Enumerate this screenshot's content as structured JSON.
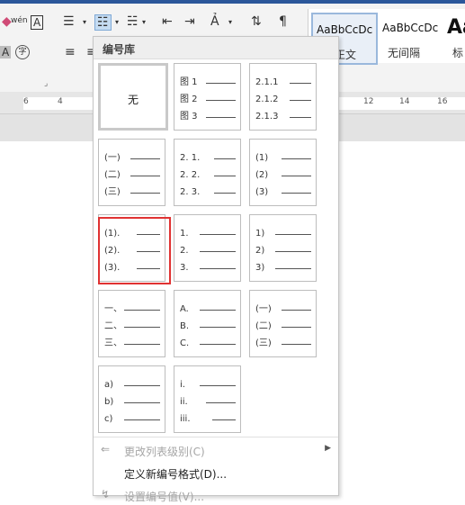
{
  "ribbon": {
    "font_wen_label": "wén",
    "font_a_boxed": "A",
    "font_a_gray": "A",
    "char_circle": "字",
    "styles": [
      {
        "sample": "AaBbCcDc",
        "label": "正文",
        "selected": true
      },
      {
        "sample": "AaBbCcDc",
        "label": "无间隔",
        "selected": false
      },
      {
        "sample": "Aa",
        "label": "标",
        "selected": false
      }
    ]
  },
  "ruler": {
    "left_numbers": [
      "6",
      "4"
    ],
    "right_numbers": [
      "12",
      "14",
      "16"
    ]
  },
  "numbering_library": {
    "title": "编号库",
    "none_label": "无",
    "tiles": [
      {
        "markers": [
          "图 1",
          "图 2",
          "图 3"
        ]
      },
      {
        "markers": [
          "2.1.1",
          "2.1.2",
          "2.1.3"
        ]
      },
      {
        "markers": [
          "(一)",
          "(二)",
          "(三)"
        ]
      },
      {
        "markers": [
          "2. 1.",
          "2. 2.",
          "2. 3."
        ]
      },
      {
        "markers": [
          "(1)",
          "(2)",
          "(3)"
        ]
      },
      {
        "markers": [
          "(1).",
          "(2).",
          "(3)."
        ]
      },
      {
        "markers": [
          "1.",
          "2.",
          "3."
        ]
      },
      {
        "markers": [
          "1)",
          "2)",
          "3)"
        ]
      },
      {
        "markers": [
          "一、",
          "二、",
          "三、"
        ]
      },
      {
        "markers": [
          "A.",
          "B.",
          "C."
        ]
      },
      {
        "markers": [
          "(一)",
          "(二)",
          "(三)"
        ]
      },
      {
        "markers": [
          "a)",
          "b)",
          "c)"
        ]
      },
      {
        "markers": [
          "i.",
          "ii.",
          "iii."
        ]
      }
    ]
  },
  "menu": {
    "change_level": "更改列表级别(C)",
    "define_format": "定义新编号格式(D)...",
    "set_value": "设置编号值(V)..."
  },
  "colors": {
    "highlight": "#e03232",
    "ribbon_bg": "#f3f3f3",
    "title_bar": "#2b579a"
  }
}
